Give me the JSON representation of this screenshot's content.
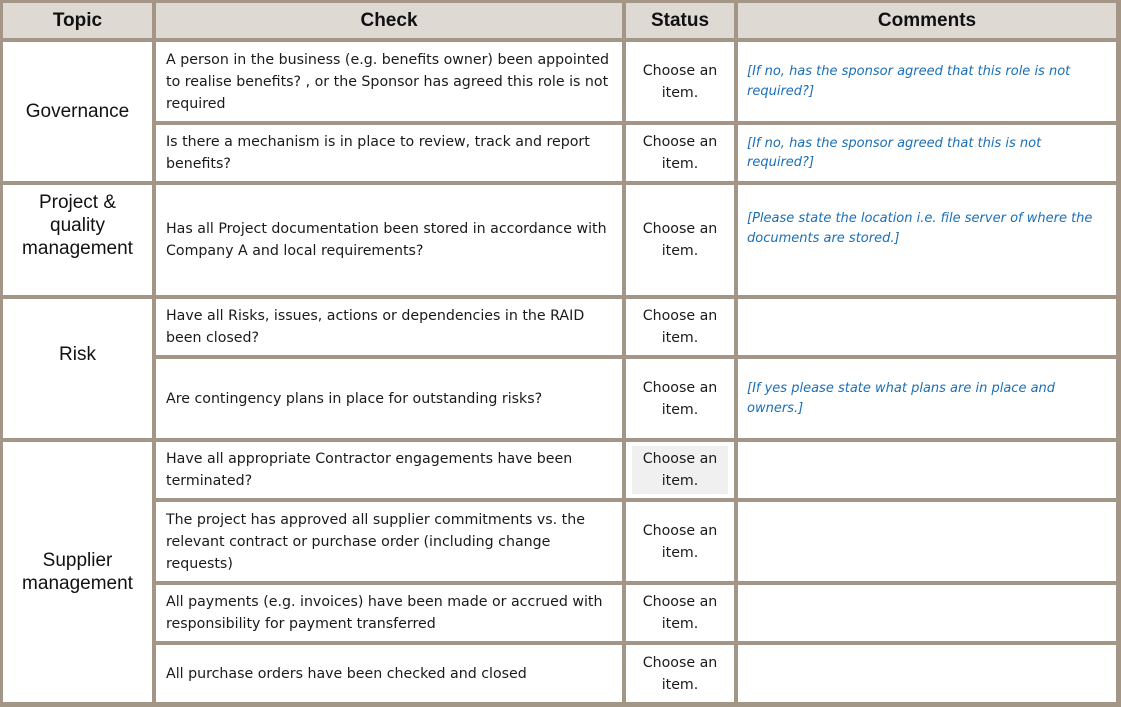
{
  "header": {
    "topic": "Topic",
    "check": "Check",
    "status": "Status",
    "comments": "Comments"
  },
  "topics": [
    {
      "label": "Governance"
    },
    {
      "label": "Project & quality management"
    },
    {
      "label": "Risk"
    },
    {
      "label": "Supplier management"
    }
  ],
  "rows": [
    {
      "topic_index": 0,
      "check": "A person in the business (e.g. benefits owner) been appointed to realise benefits? , or the Sponsor has agreed this role is not required",
      "status": "Choose an item.",
      "comment": "[If no, has the sponsor agreed that this role is not required?]"
    },
    {
      "topic_index": 0,
      "check": "Is there a mechanism is in place to review, track and report benefits?",
      "status": "Choose an item.",
      "comment": "[If no, has the sponsor agreed that this is not required?]"
    },
    {
      "topic_index": 1,
      "check": "Has all Project documentation been stored in accordance with Company A and local requirements?",
      "status": "Choose an item.",
      "comment": "[Please state the location i.e. file server of where the documents are stored.]"
    },
    {
      "topic_index": 2,
      "check": "Have all Risks, issues, actions or dependencies in the RAID been closed?",
      "status": "Choose an item.",
      "comment": ""
    },
    {
      "topic_index": 2,
      "check": "Are contingency plans in place for outstanding risks?",
      "status": "Choose an item.",
      "comment": "[If yes please state what plans are in place and owners.]"
    },
    {
      "topic_index": 3,
      "check": "Have all appropriate Contractor engagements have been terminated?",
      "status": "Choose an item.",
      "comment": "",
      "status_focused": true
    },
    {
      "topic_index": 3,
      "check": "The project has approved all supplier commitments vs. the relevant contract or purchase order (including change requests)",
      "status": "Choose an item.",
      "comment": ""
    },
    {
      "topic_index": 3,
      "check": "All payments (e.g. invoices) have been made or accrued with responsibility for payment transferred",
      "status": "Choose an item.",
      "comment": ""
    },
    {
      "topic_index": 3,
      "check": "All purchase orders have been checked and closed",
      "status": "Choose an item.",
      "comment": ""
    }
  ],
  "colors": {
    "border": "#a39686",
    "header_fill": "#dfd9d4",
    "comment_text": "#1a6fb7",
    "focused_status_fill": "#f0f0f0"
  }
}
